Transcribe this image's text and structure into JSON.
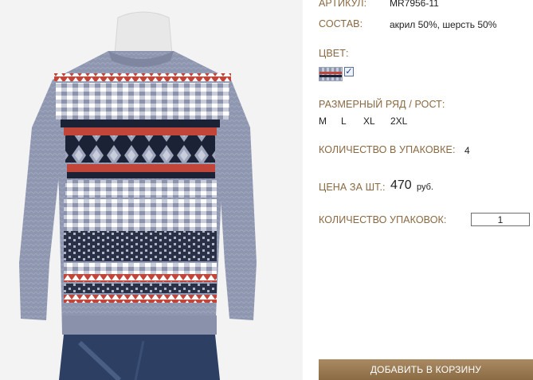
{
  "product": {
    "article_label": "АРТИКУЛ:",
    "article_value": "MR7956-11",
    "composition_label": "СОСТАВ:",
    "composition_value": "акрил 50%, шерсть 50%",
    "color_label": "ЦВЕТ:",
    "color_checked_mark": "✓",
    "size_label": "РАЗМЕРНЫЙ РЯД / РОСТ:",
    "sizes": [
      "M",
      "L",
      "XL",
      "2XL"
    ],
    "pack_qty_label": "КОЛИЧЕСТВО В УПАКОВКЕ:",
    "pack_qty_value": "4",
    "price_label": "ЦЕНА ЗА ШТ.:",
    "price_value": "470",
    "price_currency": "руб.",
    "packs_label": "КОЛИЧЕСТВО УПАКОВОК:",
    "packs_value": "1",
    "add_to_cart": "ДОБАВИТЬ В КОРЗИНУ"
  },
  "colors": {
    "label": "#8a6840",
    "button": "#9a7b54",
    "sweater_grey": "#8f97b0",
    "sweater_red": "#c2453a",
    "sweater_navy": "#1c2236"
  }
}
